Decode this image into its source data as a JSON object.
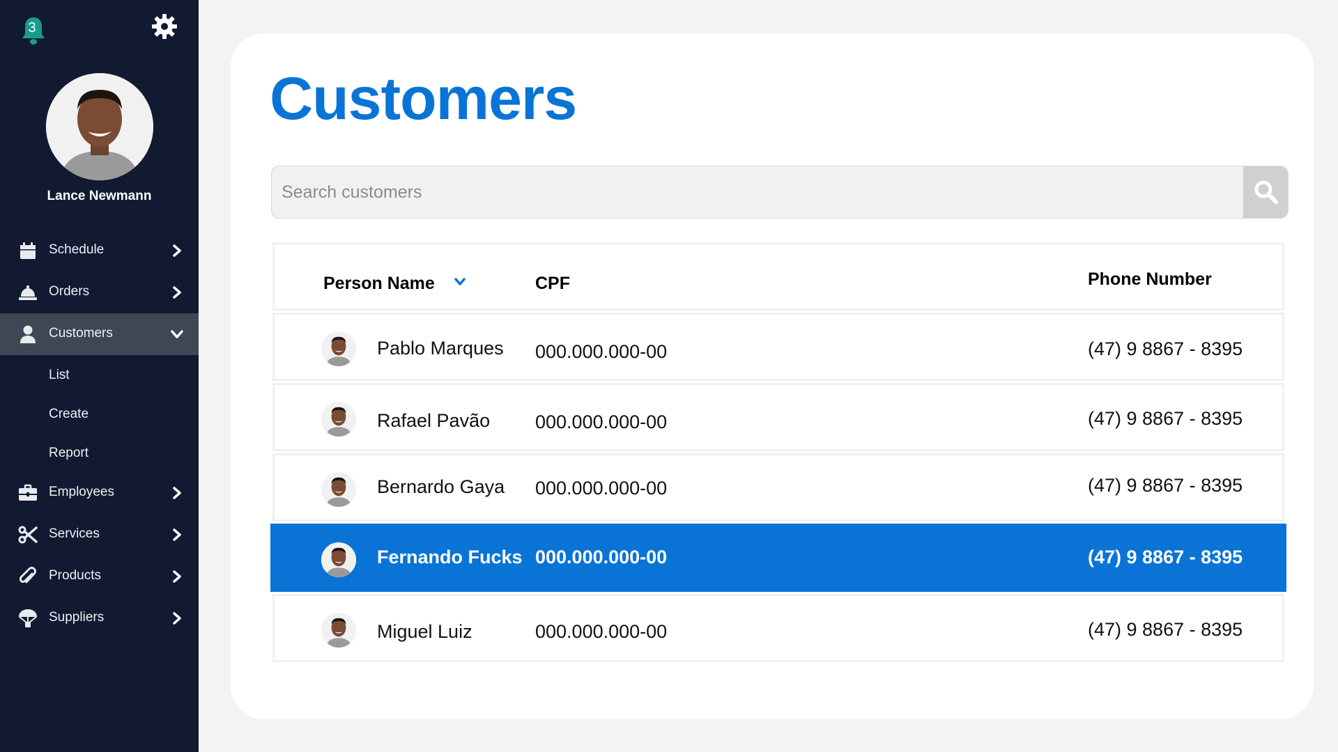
{
  "sidebar": {
    "notification_count": "3",
    "user": {
      "name": "Lance Newmann"
    },
    "menu": [
      {
        "label": "Schedule",
        "icon": "calendar-icon",
        "expanded": false
      },
      {
        "label": "Orders",
        "icon": "service-bell-icon",
        "expanded": false
      },
      {
        "label": "Customers",
        "icon": "user-icon",
        "expanded": true,
        "submenu": [
          {
            "label": "List"
          },
          {
            "label": "Create"
          },
          {
            "label": "Report"
          }
        ]
      },
      {
        "label": "Employees",
        "icon": "briefcase-icon",
        "expanded": false
      },
      {
        "label": "Services",
        "icon": "scissors-icon",
        "expanded": false
      },
      {
        "label": "Products",
        "icon": "paperclip-icon",
        "expanded": false
      },
      {
        "label": "Suppliers",
        "icon": "parachute-icon",
        "expanded": false
      }
    ]
  },
  "main": {
    "title": "Customers",
    "search": {
      "placeholder": "Search customers",
      "value": ""
    },
    "table": {
      "headers": {
        "name": "Person Name",
        "cpf": "CPF",
        "phone": "Phone Number"
      },
      "sort": "Person Name",
      "rows": [
        {
          "name": "Pablo Marques",
          "cpf": "000.000.000-00",
          "phone": "(47) 9 8867 - 8395",
          "selected": false
        },
        {
          "name": "Rafael Pavão",
          "cpf": "000.000.000-00",
          "phone": "(47) 9 8867 - 8395",
          "selected": false
        },
        {
          "name": "Bernardo Gaya",
          "cpf": "000.000.000-00",
          "phone": "(47) 9 8867 - 8395",
          "selected": false
        },
        {
          "name": "Fernando Fucks",
          "cpf": "000.000.000-00",
          "phone": "(47) 9 8867 - 8395",
          "selected": true
        },
        {
          "name": "Miguel Luiz",
          "cpf": "000.000.000-00",
          "phone": "(47) 9 8867 - 8395",
          "selected": false
        }
      ]
    }
  },
  "colors": {
    "sidebar_bg": "#111a31",
    "accent": "#0a74d6",
    "badge": "#1a9c8c",
    "active_menu_bg": "#3f4654"
  }
}
